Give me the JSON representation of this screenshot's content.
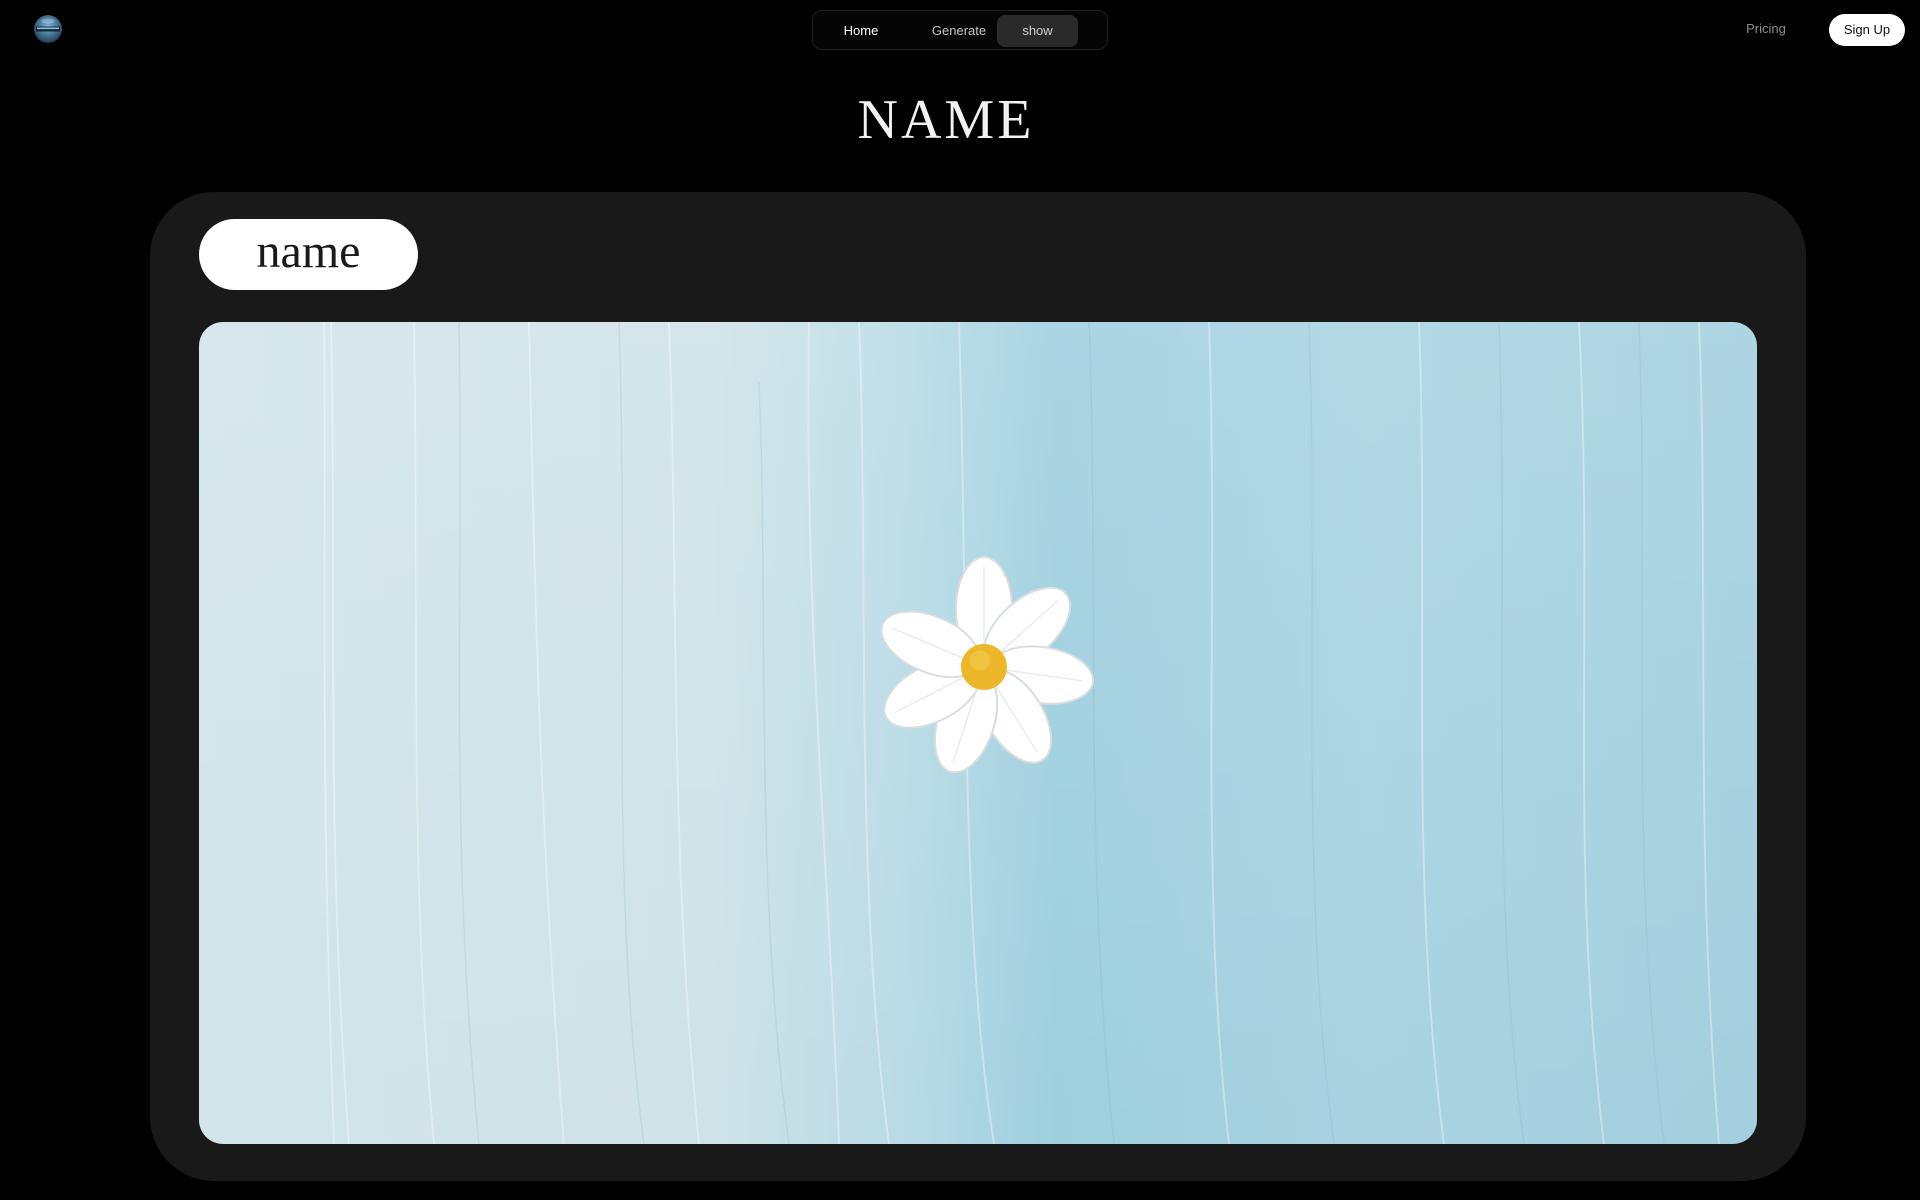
{
  "header": {
    "logo_icon": "globe-logo-icon",
    "nav": {
      "items": [
        {
          "label": "Home",
          "active": false
        },
        {
          "label": "Generate",
          "active": false
        },
        {
          "label": "show",
          "active": true
        }
      ]
    },
    "pricing_label": "Pricing",
    "signup_label": "Sign Up"
  },
  "main": {
    "title": "NAME",
    "card": {
      "name_label": "name",
      "image_icon": "daisy-flower-image"
    }
  },
  "colors": {
    "background": "#000000",
    "card": "#191919",
    "pill": "#ffffff",
    "image_left": "#cde3ea",
    "image_right": "#a6d2e0",
    "flower_center": "#ecb728"
  }
}
